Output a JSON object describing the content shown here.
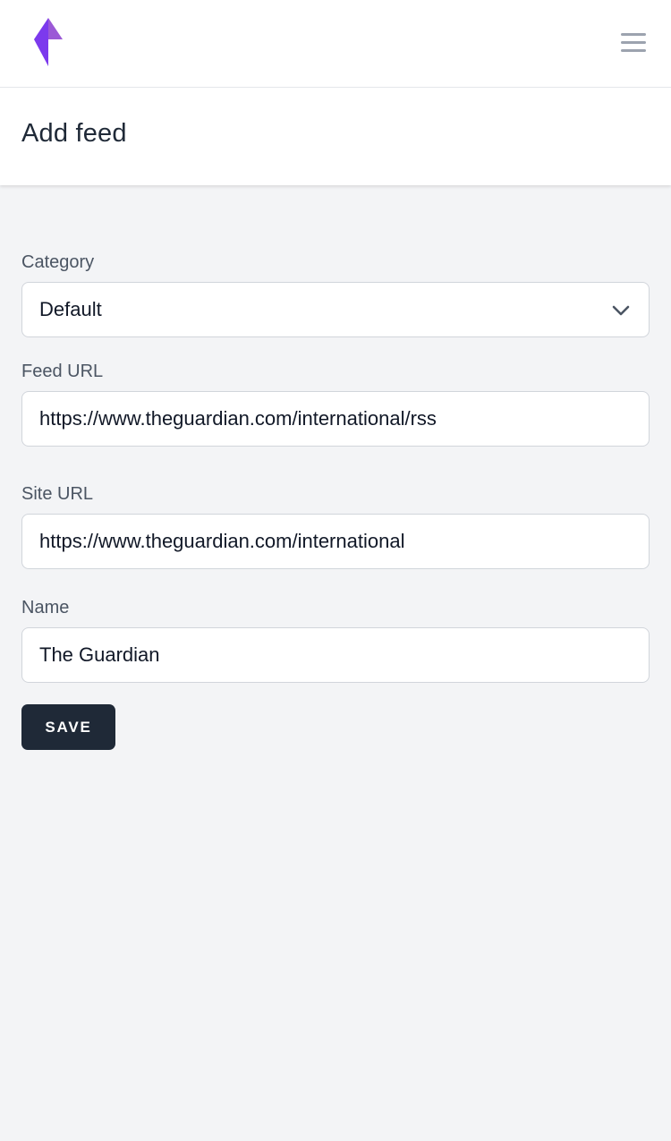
{
  "app": {
    "logo_icon": "brand-logo-icon",
    "menu_icon": "hamburger-menu-icon",
    "brand_colors": [
      "#7c3aed",
      "#9b59d6"
    ]
  },
  "header": {
    "title": "Add feed"
  },
  "form": {
    "category": {
      "label": "Category",
      "value": "Default",
      "icon": "chevron-down-icon"
    },
    "feed_url": {
      "label": "Feed URL",
      "value": "https://www.theguardian.com/international/rss"
    },
    "site_url": {
      "label": "Site URL",
      "value": "https://www.theguardian.com/international"
    },
    "name": {
      "label": "Name",
      "value": "The Guardian"
    },
    "save_label": "SAVE"
  }
}
